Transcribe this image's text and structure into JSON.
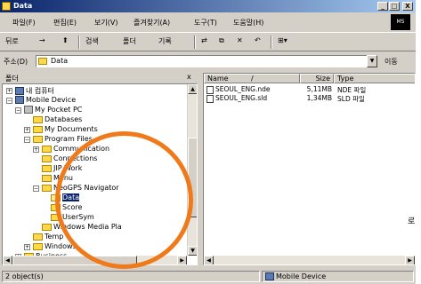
{
  "window": {
    "title": "Data",
    "min_label": "_",
    "max_label": "□",
    "close_label": "X"
  },
  "menubar": {
    "items": [
      "파일(F)",
      "편집(E)",
      "보기(V)",
      "즐겨찾기(A)",
      "도구(T)",
      "도움말(H)"
    ],
    "logo": "MS"
  },
  "toolbar": {
    "back": "뒤로",
    "forward": "→",
    "up": "⬆",
    "search": "검색",
    "folders": "폴더",
    "history": "기록",
    "move": "⇄",
    "copy": "⧉",
    "delete": "✕",
    "undo": "↶",
    "views": "⊞▾"
  },
  "address": {
    "label": "주소(D)",
    "value": "Data",
    "go": "이동"
  },
  "tree": {
    "header": "폴더",
    "close": "x",
    "items": [
      {
        "label": "내 컴퓨터",
        "level": 0,
        "icon": "computer",
        "pm": "+"
      },
      {
        "label": "Mobile Device",
        "level": 0,
        "icon": "device",
        "pm": "−"
      },
      {
        "label": "My Pocket PC",
        "level": 1,
        "icon": "handheld",
        "pm": "−"
      },
      {
        "label": "Databases",
        "level": 2,
        "icon": "folder",
        "pm": ""
      },
      {
        "label": "My Documents",
        "level": 2,
        "icon": "folder",
        "pm": "+"
      },
      {
        "label": "Program Files",
        "level": 2,
        "icon": "folder",
        "pm": "−"
      },
      {
        "label": "Communication",
        "level": 3,
        "icon": "folder",
        "pm": "+"
      },
      {
        "label": "Connections",
        "level": 3,
        "icon": "folder",
        "pm": ""
      },
      {
        "label": "JIP Work",
        "level": 3,
        "icon": "folder",
        "pm": ""
      },
      {
        "label": "Menu",
        "level": 3,
        "icon": "folder",
        "pm": ""
      },
      {
        "label": "NeoGPS Navigator",
        "level": 3,
        "icon": "folder",
        "pm": "−"
      },
      {
        "label": "Data",
        "level": 4,
        "icon": "folder-open",
        "pm": "",
        "selected": true
      },
      {
        "label": "Score",
        "level": 4,
        "icon": "folder",
        "pm": ""
      },
      {
        "label": "UserSym",
        "level": 4,
        "icon": "folder",
        "pm": ""
      },
      {
        "label": "Windows Media Pla",
        "level": 3,
        "icon": "folder",
        "pm": ""
      },
      {
        "label": "Temp",
        "level": 2,
        "icon": "folder",
        "pm": ""
      },
      {
        "label": "Windows",
        "level": 2,
        "icon": "folder",
        "pm": "+"
      },
      {
        "label": "Business",
        "level": 1,
        "icon": "folder",
        "pm": "+"
      }
    ]
  },
  "list": {
    "columns": [
      "Name",
      "Size",
      "Type"
    ],
    "sort_indicator": "/",
    "files": [
      {
        "name": "SEOUL_ENG.nde",
        "size": "5,11MB",
        "type": "NDE 파일"
      },
      {
        "name": "SEOUL_ENG.sld",
        "size": "1,34MB",
        "type": "SLD 파일"
      }
    ]
  },
  "status": {
    "selection": "2 object(s)",
    "location": "Mobile Device"
  },
  "margin_text": "로",
  "colors": {
    "highlight_circle": "#f07a1a",
    "selection": "#0a246a",
    "window": "#d4d0c8"
  }
}
